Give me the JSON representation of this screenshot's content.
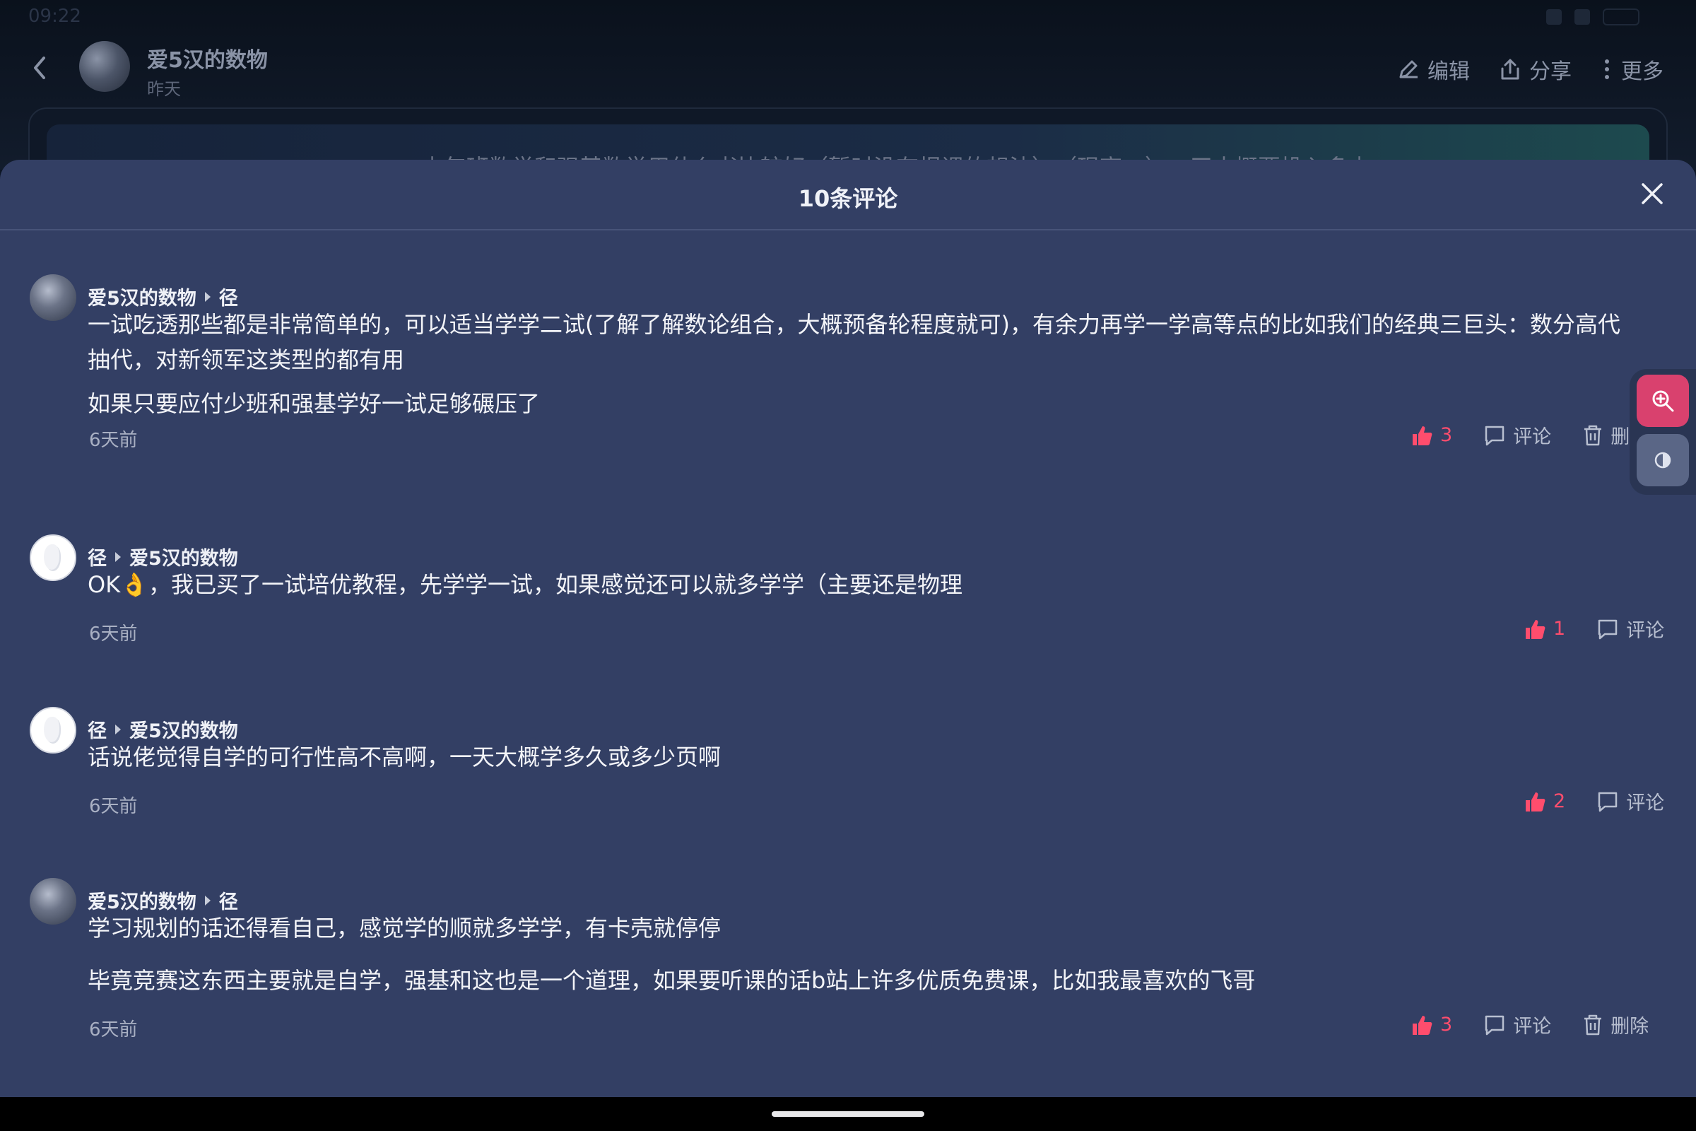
{
  "status_bar": {
    "time": "09:22"
  },
  "header": {
    "author_name": "爱5汉的数物",
    "date": "昨天",
    "actions": {
      "edit": "编辑",
      "share": "分享",
      "more": "更多"
    },
    "post_snippet": "少年班数学和强基数学用什么书比较好（暂时没有报课的想法），（现高一）一天大概要投入多少"
  },
  "sheet": {
    "title": "10条评论",
    "comments": [
      {
        "author": "爱5汉的数物",
        "reply_to": "径",
        "paragraphs": [
          "一试吃透那些都是非常简单的，可以适当学学二试(了解了解数论组合，大概预备轮程度就可)，有余力再学一学高等点的比如我们的经典三巨头：数分高代抽代，对新领军这类型的都有用",
          "如果只要应付少班和强基学好一试足够碾压了"
        ],
        "time": "6天前",
        "likes": "3",
        "comment_label": "评论",
        "delete_label": "删除"
      },
      {
        "author": "径",
        "reply_to": "爱5汉的数物",
        "paragraphs": [
          "OK👌，我已买了一试培优教程，先学学一试，如果感觉还可以就多学学（主要还是物理"
        ],
        "time": "6天前",
        "likes": "1",
        "comment_label": "评论"
      },
      {
        "author": "径",
        "reply_to": "爱5汉的数物",
        "paragraphs": [
          "话说佬觉得自学的可行性高不高啊，一天大概学多久或多少页啊"
        ],
        "time": "6天前",
        "likes": "2",
        "comment_label": "评论"
      },
      {
        "author": "爱5汉的数物",
        "reply_to": "径",
        "paragraphs": [
          "学习规划的话还得看自己，感觉学的顺就多学学，有卡壳就停停",
          "毕竟竞赛这东西主要就是自学，强基和这也是一个道理，如果要听课的话b站上许多优质免费课，比如我最喜欢的飞哥"
        ],
        "time": "6天前",
        "likes": "3",
        "comment_label": "评论",
        "delete_label": "删除"
      }
    ]
  },
  "colors": {
    "sheet_bg": "#333f64",
    "like": "#ff4d6d",
    "zoom_tool": "#d9416e"
  }
}
